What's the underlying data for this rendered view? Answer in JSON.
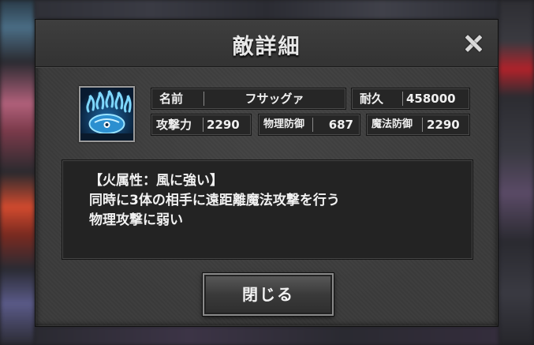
{
  "dialog": {
    "title": "敵詳細",
    "close_button_label": "閉じる"
  },
  "enemy": {
    "name_label": "名前",
    "name_value": "フサッグァ",
    "durability_label": "耐久",
    "durability_value": "458000",
    "attack_label": "攻撃力",
    "attack_value": "2290",
    "phys_def_label": "物理防御",
    "phys_def_value": "687",
    "magic_def_label": "魔法防御",
    "magic_def_value": "2290",
    "portrait_icon": "flame-creature-icon"
  },
  "description": {
    "lines": [
      "【火属性：風に強い】",
      "同時に3体の相手に遠距離魔法攻撃を行う",
      "物理攻撃に弱い"
    ]
  },
  "colors": {
    "panel": "#3b3b3b",
    "cell": "#262626",
    "text": "#f0f0f0",
    "portrait_bg": "#0d2a4a",
    "flame_blue": "#6ad0ff"
  }
}
